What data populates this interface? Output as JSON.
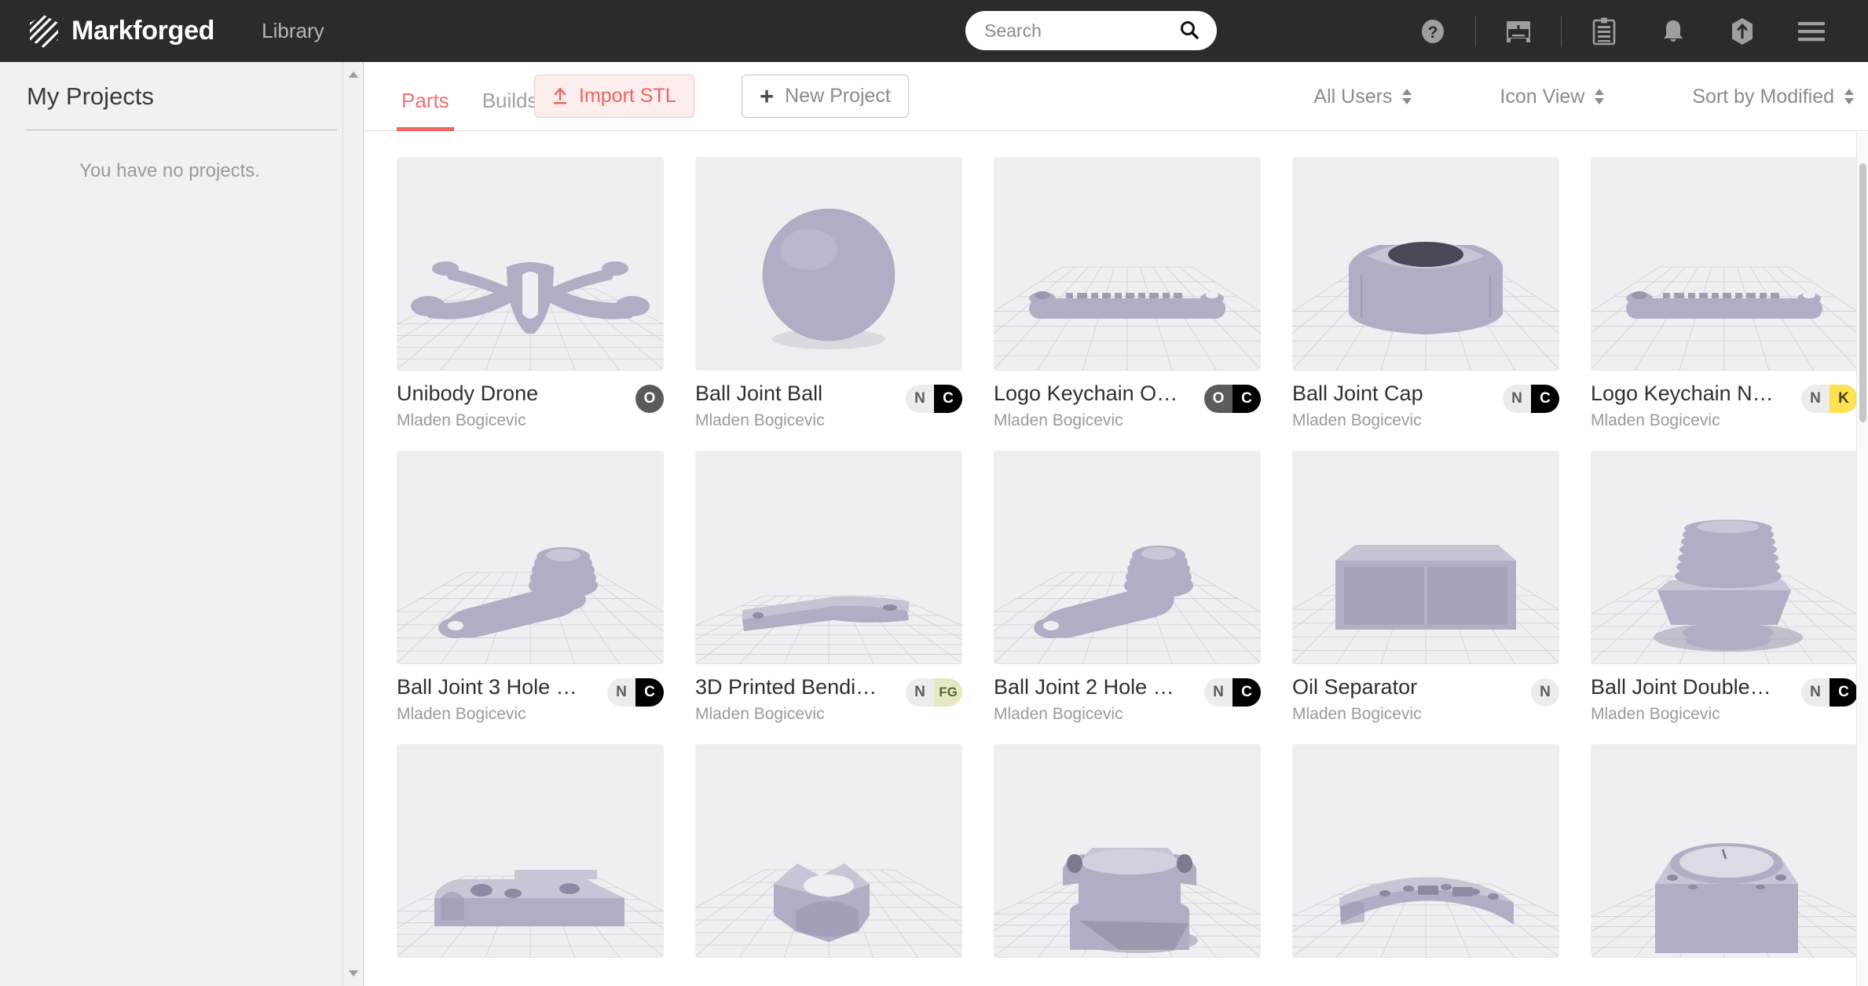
{
  "topnav": {
    "brand_name": "Markforged",
    "brand_logo_icon": "markforged-hex-logo",
    "nav_link": "Library",
    "search": {
      "placeholder": "Search",
      "value": "",
      "icon": "search-icon"
    },
    "icons": [
      {
        "name": "help-icon",
        "glyph": "?"
      },
      {
        "name": "printer-icon",
        "glyph": "printer"
      },
      {
        "name": "clipboard-icon",
        "glyph": "clipboard"
      },
      {
        "name": "bell-icon",
        "glyph": "bell"
      },
      {
        "name": "upload-hex-icon",
        "glyph": "upload"
      },
      {
        "name": "hamburger-menu-icon",
        "glyph": "menu"
      }
    ]
  },
  "sidebar": {
    "title": "My Projects",
    "empty_message": "You have no projects.",
    "scrollbar": {
      "up_arrow": "scroll-up-arrow",
      "down_arrow": "scroll-down-arrow"
    }
  },
  "toolbar": {
    "tabs": [
      {
        "label": "Parts",
        "active": true
      },
      {
        "label": "Builds",
        "active": false
      }
    ],
    "import_button": {
      "label": "Import STL",
      "icon": "upload-arrow-icon"
    },
    "new_project_button": {
      "label": "New Project",
      "icon": "plus-icon"
    },
    "filters": [
      {
        "name": "user-filter",
        "label": "All Users"
      },
      {
        "name": "view-mode",
        "label": "Icon View"
      },
      {
        "name": "sort-order",
        "label": "Sort by Modified"
      }
    ]
  },
  "colors": {
    "accent": "#ef6360",
    "topnav_bg": "#2b2b2b",
    "sidebar_bg": "#f1f1f1",
    "card_bg": "#efeff1",
    "model_fill": "#b0aec4",
    "badge_k": "#ffe153",
    "badge_fg": "#e4e9c4"
  },
  "parts": [
    {
      "name": "Unibody Drone",
      "owner": "Mladen Bogicevic",
      "badges": [
        {
          "label": "O",
          "style": "O"
        }
      ],
      "thumb": "drone"
    },
    {
      "name": "Ball Joint Ball",
      "owner": "Mladen Bogicevic",
      "badges": [
        {
          "label": "N",
          "style": "N"
        },
        {
          "label": "C",
          "style": "C"
        }
      ],
      "thumb": "sphere"
    },
    {
      "name": "Logo Keychain O…",
      "owner": "Mladen Bogicevic",
      "badges": [
        {
          "label": "O",
          "style": "O"
        },
        {
          "label": "C",
          "style": "C"
        }
      ],
      "thumb": "keychain"
    },
    {
      "name": "Ball Joint Cap",
      "owner": "Mladen Bogicevic",
      "badges": [
        {
          "label": "N",
          "style": "N"
        },
        {
          "label": "C",
          "style": "C"
        }
      ],
      "thumb": "cap"
    },
    {
      "name": "Logo Keychain N…",
      "owner": "Mladen Bogicevic",
      "badges": [
        {
          "label": "N",
          "style": "N"
        },
        {
          "label": "K",
          "style": "K"
        }
      ],
      "thumb": "keychain"
    },
    {
      "name": "Ball Joint 3 Hole …",
      "owner": "Mladen Bogicevic",
      "badges": [
        {
          "label": "N",
          "style": "N"
        },
        {
          "label": "C",
          "style": "C"
        }
      ],
      "thumb": "arm3"
    },
    {
      "name": "3D Printed Bendi…",
      "owner": "Mladen Bogicevic",
      "badges": [
        {
          "label": "N",
          "style": "N"
        },
        {
          "label": "FG",
          "style": "FG"
        }
      ],
      "thumb": "flat"
    },
    {
      "name": "Ball Joint 2 Hole …",
      "owner": "Mladen Bogicevic",
      "badges": [
        {
          "label": "N",
          "style": "N"
        },
        {
          "label": "C",
          "style": "C"
        }
      ],
      "thumb": "arm2"
    },
    {
      "name": "Oil Separator",
      "owner": "Mladen Bogicevic",
      "badges": [
        {
          "label": "N",
          "style": "N"
        }
      ],
      "thumb": "box"
    },
    {
      "name": "Ball Joint Double…",
      "owner": "Mladen Bogicevic",
      "badges": [
        {
          "label": "N",
          "style": "N"
        },
        {
          "label": "C",
          "style": "C"
        }
      ],
      "thumb": "threaded"
    },
    {
      "name": "",
      "owner": "",
      "badges": [],
      "thumb": "plate"
    },
    {
      "name": "",
      "owner": "",
      "badges": [],
      "thumb": "star"
    },
    {
      "name": "",
      "owner": "",
      "badges": [],
      "thumb": "tube"
    },
    {
      "name": "",
      "owner": "",
      "badges": [],
      "thumb": "curved"
    },
    {
      "name": "",
      "owner": "",
      "badges": [],
      "thumb": "cylbox"
    }
  ]
}
